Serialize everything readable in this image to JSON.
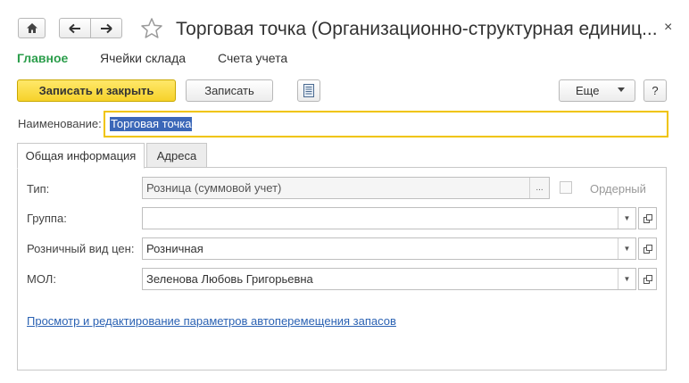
{
  "window": {
    "title": "Торговая точка (Организационно-структурная единиц...",
    "close_label": "×"
  },
  "nav_tabs": [
    {
      "label": "Главное"
    },
    {
      "label": "Ячейки склада"
    },
    {
      "label": "Счета учета"
    }
  ],
  "toolbar": {
    "save_close_label": "Записать и закрыть",
    "save_label": "Записать",
    "more_label": "Еще",
    "help_label": "?"
  },
  "form": {
    "name_label": "Наименование:",
    "name_value": "Торговая точка"
  },
  "tabs": [
    {
      "label": "Общая информация"
    },
    {
      "label": "Адреса"
    }
  ],
  "fields": {
    "type": {
      "label": "Тип:",
      "value": "Розница (суммовой учет)",
      "select_label": "..."
    },
    "order_checkbox_label": "Ордерный",
    "group": {
      "label": "Группа:",
      "value": ""
    },
    "price_type": {
      "label": "Розничный вид цен:",
      "value": "Розничная"
    },
    "mol": {
      "label": "МОЛ:",
      "value": "Зеленова Любовь Григорьевна"
    }
  },
  "link_text": "Просмотр и редактирование параметров автоперемещения запасов",
  "colors": {
    "accent_green": "#2a9d4a",
    "primary_button": "#f6d22a",
    "link_blue": "#2b62b3",
    "focus_border": "#f0c400",
    "selection": "#3b67b8"
  },
  "icons": {
    "home": "home-icon",
    "back": "arrow-left-icon",
    "forward": "arrow-right-icon",
    "favorite": "star-icon",
    "document": "document-list-icon"
  }
}
